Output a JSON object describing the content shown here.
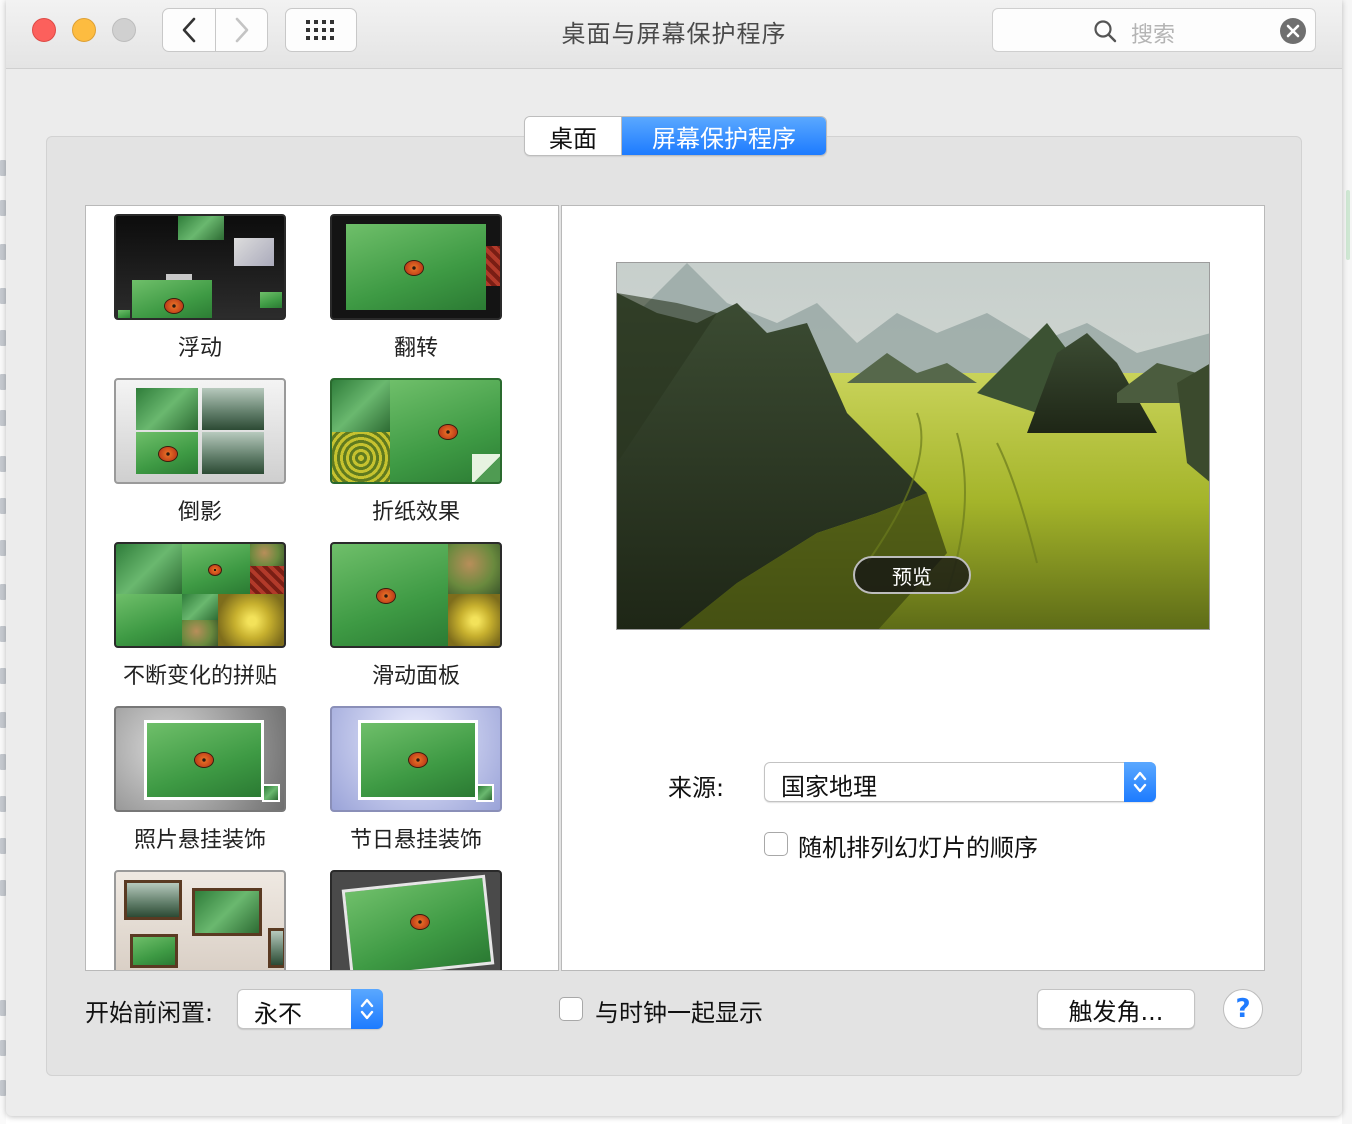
{
  "window": {
    "title": "桌面与屏幕保护程序",
    "search_placeholder": "搜索"
  },
  "tabs": [
    {
      "label": "桌面",
      "selected": false
    },
    {
      "label": "屏幕保护程序",
      "selected": true
    }
  ],
  "savers": [
    {
      "label": "浮动"
    },
    {
      "label": "翻转"
    },
    {
      "label": "倒影"
    },
    {
      "label": "折纸效果"
    },
    {
      "label": "不断变化的拼贴"
    },
    {
      "label": "滑动面板"
    },
    {
      "label": "照片悬挂装饰"
    },
    {
      "label": "节日悬挂装饰"
    },
    {
      "label": ""
    },
    {
      "label": ""
    }
  ],
  "preview": {
    "button_label": "预览"
  },
  "source": {
    "label": "来源:",
    "value": "国家地理"
  },
  "shuffle": {
    "label": "随机排列幻灯片的顺序",
    "checked": false
  },
  "bottom": {
    "idle_label": "开始前闲置:",
    "idle_value": "永不",
    "clock_label": "与时钟一起显示",
    "clock_checked": false,
    "hot_corners_label": "触发角...",
    "help_label": "?"
  },
  "colors": {
    "accent": "#1d7bff",
    "close": "#fc605c",
    "minimize": "#fdbc40"
  }
}
